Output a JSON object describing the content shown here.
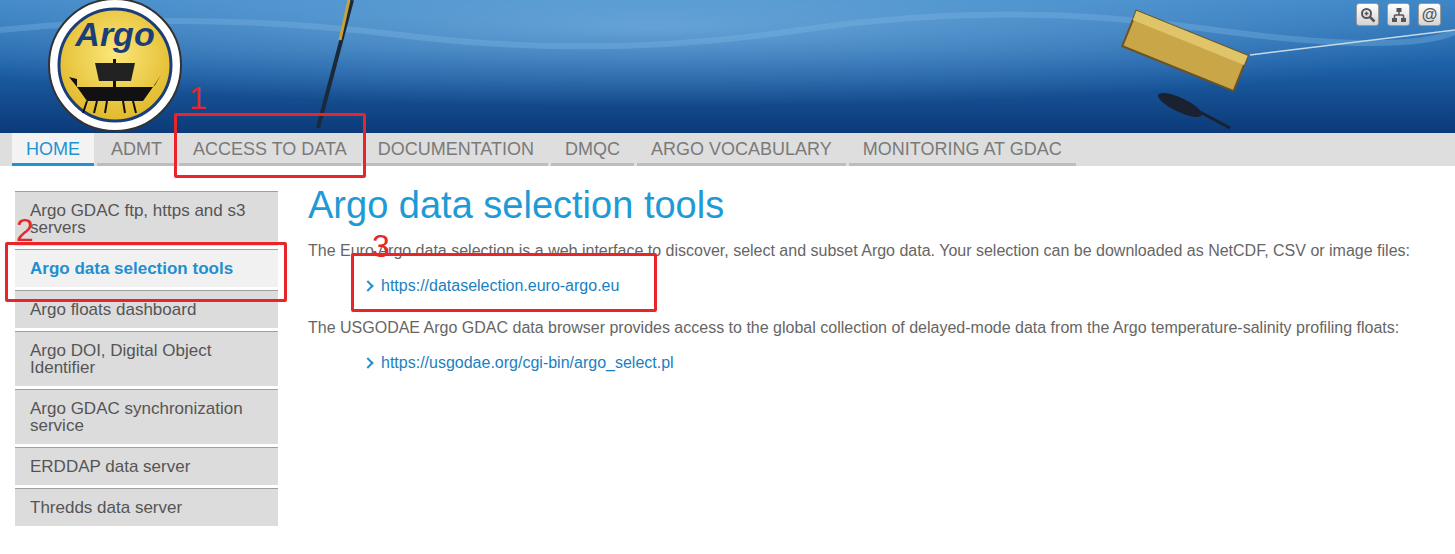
{
  "logo": {
    "text": "Argo"
  },
  "header_tools": {
    "contact_glyph": "@"
  },
  "nav": {
    "tabs": [
      {
        "label": "HOME",
        "selected": true
      },
      {
        "label": "ADMT",
        "selected": false
      },
      {
        "label": "ACCESS TO DATA",
        "selected": false,
        "annotation": {
          "number": "1"
        }
      },
      {
        "label": "DOCUMENTATION",
        "selected": false
      },
      {
        "label": "DMQC",
        "selected": false
      },
      {
        "label": "ARGO VOCABULARY",
        "selected": false
      },
      {
        "label": "MONITORING AT GDAC",
        "selected": false
      }
    ]
  },
  "sidebar": {
    "items": [
      {
        "label": "Argo GDAC ftp, https and s3 servers",
        "selected": false
      },
      {
        "label": "Argo data selection tools",
        "selected": true,
        "annotation": {
          "number": "2"
        }
      },
      {
        "label": "Argo floats dashboard",
        "selected": false
      },
      {
        "label": "Argo DOI, Digital Object Identifier",
        "selected": false
      },
      {
        "label": "Argo GDAC synchronization service",
        "selected": false
      },
      {
        "label": "ERDDAP data server",
        "selected": false
      },
      {
        "label": "Thredds data server",
        "selected": false
      }
    ]
  },
  "content": {
    "title": "Argo data selection tools",
    "sections": [
      {
        "text": "The Euro Argo data selection is a web interface to discover, select and subset Argo data. Your selection can be downloaded as NetCDF, CSV or image files:",
        "links": [
          {
            "url": "https://dataselection.euro-argo.eu",
            "annotation": {
              "number": "3"
            }
          }
        ]
      },
      {
        "text": "The USGODAE Argo GDAC data browser provides access to the global collection of delayed-mode data from the Argo temperature-salinity profiling floats:",
        "links": [
          {
            "url": "https://usgodae.org/cgi-bin/argo_select.pl"
          }
        ]
      }
    ]
  }
}
